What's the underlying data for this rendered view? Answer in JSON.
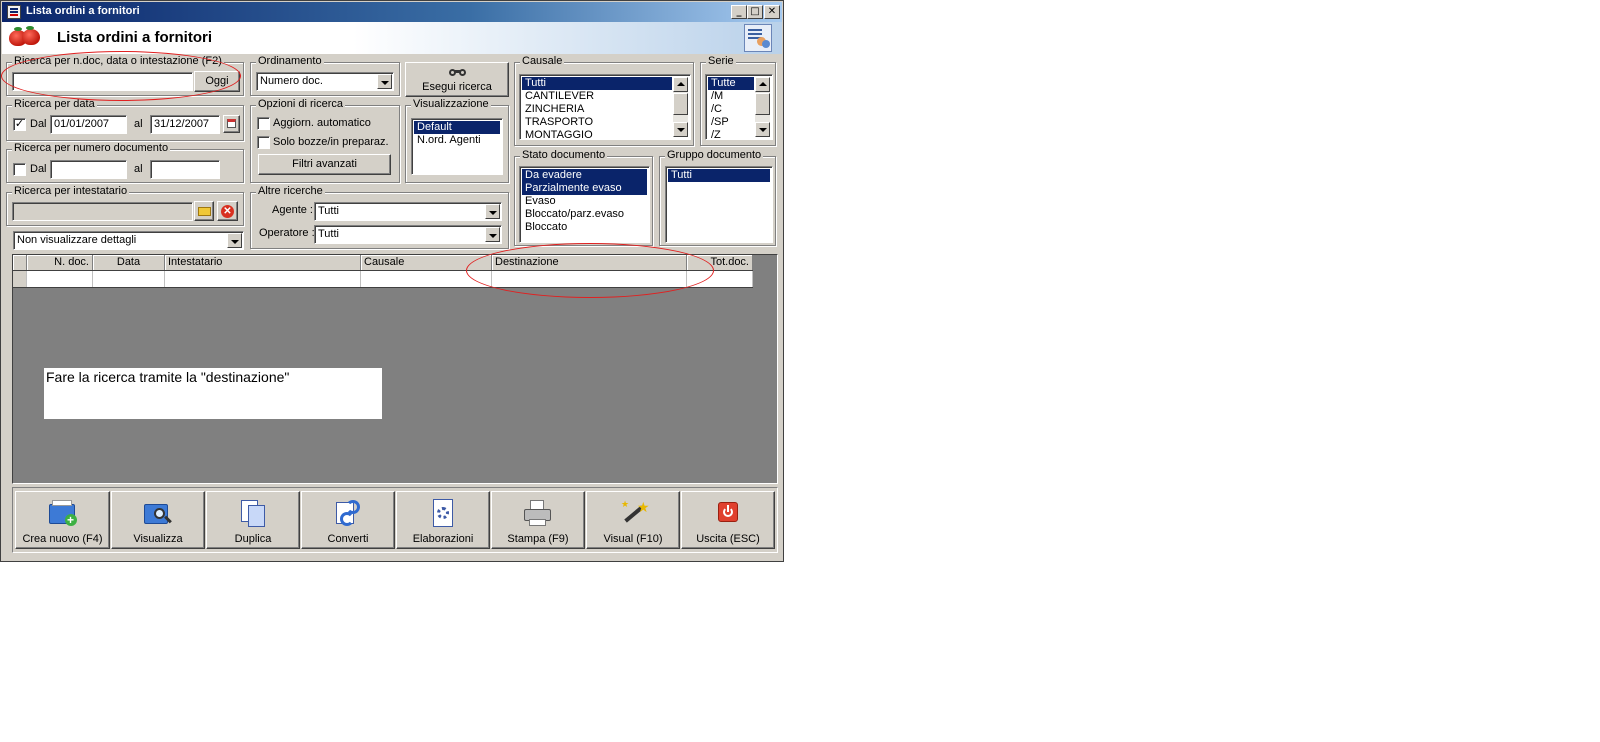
{
  "window": {
    "title": "Lista ordini a fornitori",
    "header_title": "Lista ordini a fornitori",
    "minimize": "_",
    "maximize": "□",
    "close": "✕"
  },
  "search_quick": {
    "legend": "Ricerca per n.doc, data o intestazione (F2)",
    "value": "",
    "today_button": "Oggi"
  },
  "ordering": {
    "legend": "Ordinamento",
    "selected": "Numero doc."
  },
  "run_search_button": "Esegui ricerca",
  "search_by_date": {
    "legend": "Ricerca per data",
    "checked": true,
    "from_label": "Dal",
    "from_value": "01/01/2007",
    "to_label": "al",
    "to_value": "31/12/2007"
  },
  "search_options": {
    "legend": "Opzioni di ricerca",
    "auto_update_label": "Aggiorn. automatico",
    "drafts_only_label": "Solo bozze/in preparaz.",
    "advanced_filters_button": "Filtri avanzati"
  },
  "view": {
    "legend": "Visualizzazione",
    "items": [
      "Default",
      "N.ord. Agenti"
    ],
    "selected_index": 0
  },
  "search_by_number": {
    "legend": "Ricerca per numero documento",
    "from_label": "Dal",
    "from_value": "",
    "to_label": "al",
    "to_value": ""
  },
  "search_by_holder": {
    "legend": "Ricerca per intestatario",
    "value": ""
  },
  "details_select": {
    "selected": "Non visualizzare dettagli"
  },
  "other_searches": {
    "legend": "Altre ricerche",
    "agent_label": "Agente :",
    "agent_value": "Tutti",
    "operator_label": "Operatore :",
    "operator_value": "Tutti"
  },
  "causale": {
    "legend": "Causale",
    "items": [
      "Tutti",
      "CANTILEVER",
      "ZINCHERIA",
      "TRASPORTO",
      "MONTAGGIO"
    ],
    "selected": [
      0
    ]
  },
  "serie": {
    "legend": "Serie",
    "items": [
      "Tutte",
      "/M",
      "/C",
      "/SP",
      "/Z"
    ],
    "selected": [
      0
    ]
  },
  "document_state": {
    "legend": "Stato documento",
    "items": [
      "Da evadere",
      "Parzialmente evaso",
      "Evaso",
      "Bloccato/parz.evaso",
      "Bloccato"
    ],
    "selected": [
      0,
      1
    ]
  },
  "document_group": {
    "legend": "Gruppo documento",
    "items": [
      "Tutti"
    ],
    "selected": [
      0
    ]
  },
  "grid": {
    "columns": [
      "N. doc.",
      "Data",
      "Intestatario",
      "Causale",
      "Destinazione",
      "Tot.doc."
    ]
  },
  "note_text": "Fare la ricerca tramite la \"destinazione\"",
  "toolbar": {
    "buttons": [
      {
        "label": "Crea nuovo (F4)",
        "icon": "new-document-icon"
      },
      {
        "label": "Visualizza",
        "icon": "view-document-icon"
      },
      {
        "label": "Duplica",
        "icon": "duplicate-icon"
      },
      {
        "label": "Converti",
        "icon": "convert-icon"
      },
      {
        "label": "Elaborazioni",
        "icon": "processing-icon"
      },
      {
        "label": "Stampa (F9)",
        "icon": "printer-icon"
      },
      {
        "label": "Visual (F10)",
        "icon": "magic-wand-icon"
      },
      {
        "label": "Uscita (ESC)",
        "icon": "power-icon"
      }
    ]
  },
  "colors": {
    "selection": "#0a246a",
    "annotation": "#e02020",
    "face": "#d4d0c8"
  }
}
